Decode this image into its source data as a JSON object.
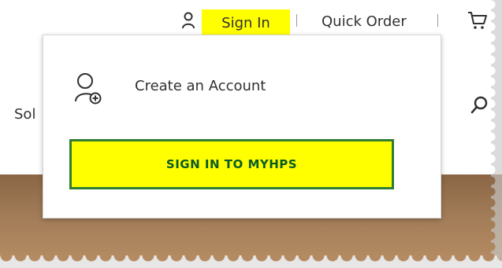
{
  "header": {
    "sign_in_label": "Sign In",
    "quick_order_label": "Quick Order",
    "icons": [
      "user-icon",
      "cart-icon"
    ]
  },
  "nav": {
    "partial_item": "Sol",
    "icons": [
      "search-icon"
    ]
  },
  "dropdown": {
    "create_account_label": "Create an Account",
    "myhps_button_label": "SIGN IN TO MYHPS",
    "icons": [
      "add-user-icon"
    ]
  },
  "colors": {
    "highlight": "#ffff00",
    "button_border": "#2e7d32",
    "button_text": "#0b5b24",
    "banner": "#a27c58"
  }
}
